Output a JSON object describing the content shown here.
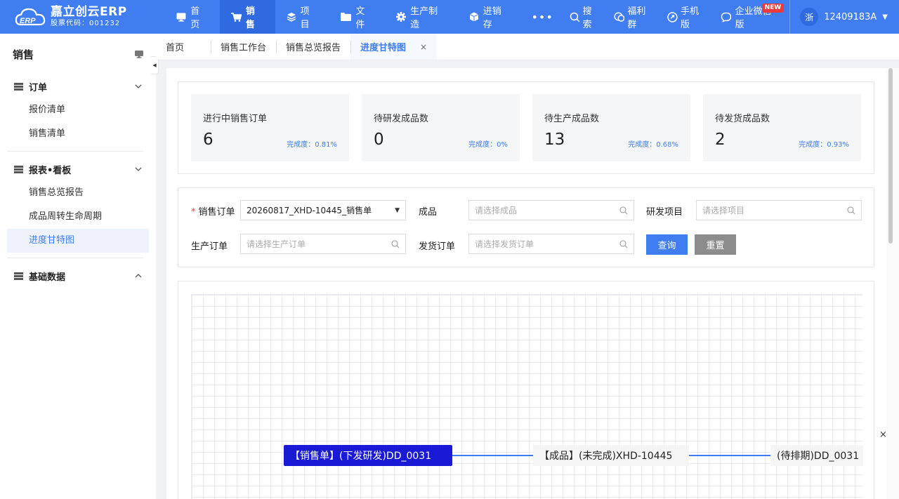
{
  "brand": {
    "name": "嘉立创云ERP",
    "stock_code": "股票代码：001232",
    "badge": "ERP"
  },
  "nav": [
    {
      "label": "首页",
      "icon": "monitor-icon",
      "active": false
    },
    {
      "label": "销售",
      "icon": "cart-icon",
      "active": true
    },
    {
      "label": "项目",
      "icon": "layers-icon",
      "active": false
    },
    {
      "label": "文件",
      "icon": "folder-icon",
      "active": false
    },
    {
      "label": "生产制造",
      "icon": "gear-icon",
      "active": false
    },
    {
      "label": "进销存",
      "icon": "box-icon",
      "active": false
    }
  ],
  "nav_more": "•••",
  "tools": {
    "search": "搜索",
    "welfare": "福利群",
    "mobile": "手机版",
    "wecom": "企业微信版",
    "new_badge": "NEW"
  },
  "user": {
    "avatar": "浙",
    "id": "12409183A"
  },
  "sidebar": {
    "title": "销售",
    "groups": [
      {
        "label": "订单",
        "expanded": true,
        "items": [
          "报价清单",
          "销售清单"
        ]
      },
      {
        "label": "报表•看板",
        "expanded": true,
        "items": [
          "销售总览报告",
          "成品周转生命周期",
          "进度甘特图"
        ]
      },
      {
        "label": "基础数据",
        "expanded": false,
        "items": []
      }
    ],
    "active_item": "进度甘特图"
  },
  "tabs": [
    {
      "label": "首页"
    },
    {
      "label": "销售工作台"
    },
    {
      "label": "销售总览报告"
    },
    {
      "label": "进度甘特图",
      "active": true,
      "close": "×"
    }
  ],
  "stats": [
    {
      "label": "进行中销售订单",
      "value": "6",
      "rate": "完成度：0.81%"
    },
    {
      "label": "待研发成品数",
      "value": "0",
      "rate": "完成度：0%"
    },
    {
      "label": "待生产成品数",
      "value": "13",
      "rate": "完成度：0.68%"
    },
    {
      "label": "待发货成品数",
      "value": "2",
      "rate": "完成度：0.93%"
    }
  ],
  "filters": {
    "sales_order_label": "销售订单",
    "sales_order_required": "*",
    "sales_order_value": "20260817_XHD-10445_销售单",
    "product_label": "成品",
    "product_placeholder": "请选择成品",
    "project_label": "研发项目",
    "project_placeholder": "请选择项目",
    "production_label": "生产订单",
    "production_placeholder": "请选择生产订单",
    "shipping_label": "发货订单",
    "shipping_placeholder": "请选择发货订单",
    "query_button": "查询",
    "reset_button": "重置"
  },
  "gantt": {
    "nodes": [
      {
        "label": "【销售单】(下发研发)DD_0031",
        "style": "primary"
      },
      {
        "label": "【成品】(未完成)XHD-10445",
        "style": "plain"
      },
      {
        "label": "(待排期)DD_0031",
        "style": "plain"
      }
    ]
  },
  "float_close": "×",
  "colors": {
    "primary": "#3f7df0",
    "node_primary": "#1a1ad6",
    "link": "#3f7df0"
  }
}
